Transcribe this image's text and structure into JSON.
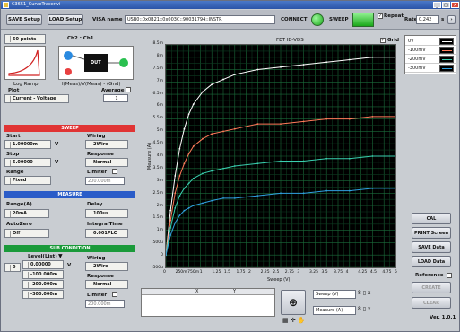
{
  "window": {
    "title": "C3651_CurveTracer.vi"
  },
  "toolbar": {
    "save_setup": "SAVE Setup",
    "load_setup": "LOAD Setup",
    "visa_label": "VISA name",
    "visa_value": "USB0::0x0B21::0x003C::90031794::INSTR",
    "connect_label": "CONNECT",
    "sweep_label": "SWEEP",
    "repeat_label": "Repeat",
    "rate_label": "Rate",
    "rate_value": "0.242",
    "rate_unit": "s"
  },
  "left": {
    "points_value": "50 points",
    "ch_label": "Ch2 : Ch1",
    "ramp_label": "Log Ramp",
    "meas_label": "I(Meas)/V(Meas) - (Gnd)",
    "plot_label": "Plot",
    "plot_value": "Current - Voltage",
    "average_label": "Average",
    "average_value": "1",
    "dut_label": "DUT",
    "sweep_header": "SWEEP",
    "start_label": "Start",
    "start_value": "1.00000m",
    "start_unit": "V",
    "wiring_label": "Wiring",
    "wiring_value": "2Wire",
    "stop_label": "Stop",
    "stop_value": "5.00000",
    "stop_unit": "V",
    "response_label": "Response",
    "response_value": "Normal",
    "range_label": "Range",
    "range_value": "Fixed",
    "limiter_label": "Limiter",
    "limiter_value": "200.000m",
    "measure_header": "MEASURE",
    "mrange_label": "Range(A)",
    "mrange_value": "20mA",
    "delay_label": "Delay",
    "delay_value": "100us",
    "autozero_label": "AutoZero",
    "autozero_value": "Off",
    "integ_label": "IntegralTime",
    "integ_value": "0.001PLC",
    "subcond_header": "SUB CONDITION",
    "level_label": "Level(List)",
    "level_idx": "0",
    "level_values": [
      "0.00000",
      "-100.000m",
      "-200.000m",
      "-300.000m"
    ],
    "level_unit": "V",
    "sub_wiring_label": "Wiring",
    "sub_wiring_value": "2Wire",
    "sub_response_label": "Response",
    "sub_response_value": "Normal",
    "sub_limiter_label": "Limiter",
    "sub_limiter_value": "200.000m"
  },
  "graph": {
    "title": "FET ID-VDS",
    "grid_label": "Grid",
    "ylabel": "Measure (A)",
    "xlabel": "Sweep (V)",
    "yticks": [
      "8.5m",
      "8m",
      "7.5m",
      "7m",
      "6.5m",
      "6m",
      "5.5m",
      "5m",
      "4.5m",
      "4m",
      "3.5m",
      "3m",
      "2.5m",
      "2m",
      "1.5m",
      "1m",
      "500u",
      "0",
      "-500u"
    ],
    "xticks": [
      "0",
      "250m",
      "750m",
      "1",
      "1.25",
      "1.5",
      "1.75",
      "2",
      "2.25",
      "2.5",
      "2.75",
      "3",
      "3.25",
      "3.5",
      "3.75",
      "4",
      "4.25",
      "4.5",
      "4.75",
      "5"
    ]
  },
  "legend": {
    "items": [
      "0V",
      "-100mV",
      "-200mV",
      "-300mV"
    ],
    "colors": [
      "#ffffff",
      "#ff7a5a",
      "#3ad0b0",
      "#30a0e0"
    ]
  },
  "cursor": {
    "col_x": "X",
    "col_y": "Y",
    "sweep_sel": "Sweep (V)",
    "measure_sel": "Measure (A)"
  },
  "right_buttons": {
    "cal": "CAL",
    "print": "PRINT Screen",
    "save": "SAVE Data",
    "load": "LOAD Data",
    "reference": "Reference",
    "create": "CREATE",
    "clear": "CLEAR",
    "version": "Ver. 1.0.1"
  },
  "chart_data": {
    "type": "line",
    "title": "FET ID-VDS",
    "xlabel": "Sweep (V)",
    "ylabel": "Measure (A)",
    "xlim": [
      0,
      5
    ],
    "ylim": [
      -0.0005,
      0.0085
    ],
    "grid": true,
    "series": [
      {
        "name": "0V",
        "x": [
          0,
          0.1,
          0.2,
          0.3,
          0.4,
          0.5,
          0.6,
          0.8,
          1,
          1.25,
          1.5,
          2,
          2.5,
          3,
          3.5,
          4,
          4.5,
          5
        ],
        "values": [
          0,
          0.0018,
          0.0032,
          0.0043,
          0.0051,
          0.0057,
          0.0061,
          0.0066,
          0.0069,
          0.0071,
          0.0073,
          0.0075,
          0.0076,
          0.0077,
          0.0078,
          0.0079,
          0.008,
          0.008
        ]
      },
      {
        "name": "-100mV",
        "x": [
          0,
          0.1,
          0.2,
          0.3,
          0.4,
          0.5,
          0.6,
          0.8,
          1,
          1.25,
          1.5,
          2,
          2.5,
          3,
          3.5,
          4,
          4.5,
          5
        ],
        "values": [
          0,
          0.0014,
          0.0025,
          0.0032,
          0.0037,
          0.0041,
          0.0044,
          0.0047,
          0.0049,
          0.005,
          0.0051,
          0.0053,
          0.0053,
          0.0054,
          0.0055,
          0.0055,
          0.0056,
          0.0056
        ]
      },
      {
        "name": "-200mV",
        "x": [
          0,
          0.1,
          0.2,
          0.3,
          0.4,
          0.5,
          0.6,
          0.8,
          1,
          1.25,
          1.5,
          2,
          2.5,
          3,
          3.5,
          4,
          4.5,
          5
        ],
        "values": [
          0,
          0.0011,
          0.0019,
          0.0024,
          0.0027,
          0.0029,
          0.0031,
          0.0033,
          0.0034,
          0.0035,
          0.0036,
          0.0037,
          0.0038,
          0.0038,
          0.0039,
          0.0039,
          0.004,
          0.004
        ]
      },
      {
        "name": "-300mV",
        "x": [
          0,
          0.1,
          0.2,
          0.3,
          0.4,
          0.5,
          0.6,
          0.8,
          1,
          1.25,
          1.5,
          2,
          2.5,
          3,
          3.5,
          4,
          4.5,
          5
        ],
        "values": [
          0,
          0.0008,
          0.0013,
          0.0016,
          0.0018,
          0.0019,
          0.002,
          0.0021,
          0.0022,
          0.0023,
          0.0023,
          0.0024,
          0.0025,
          0.0025,
          0.0026,
          0.0026,
          0.0027,
          0.0027
        ]
      }
    ]
  }
}
